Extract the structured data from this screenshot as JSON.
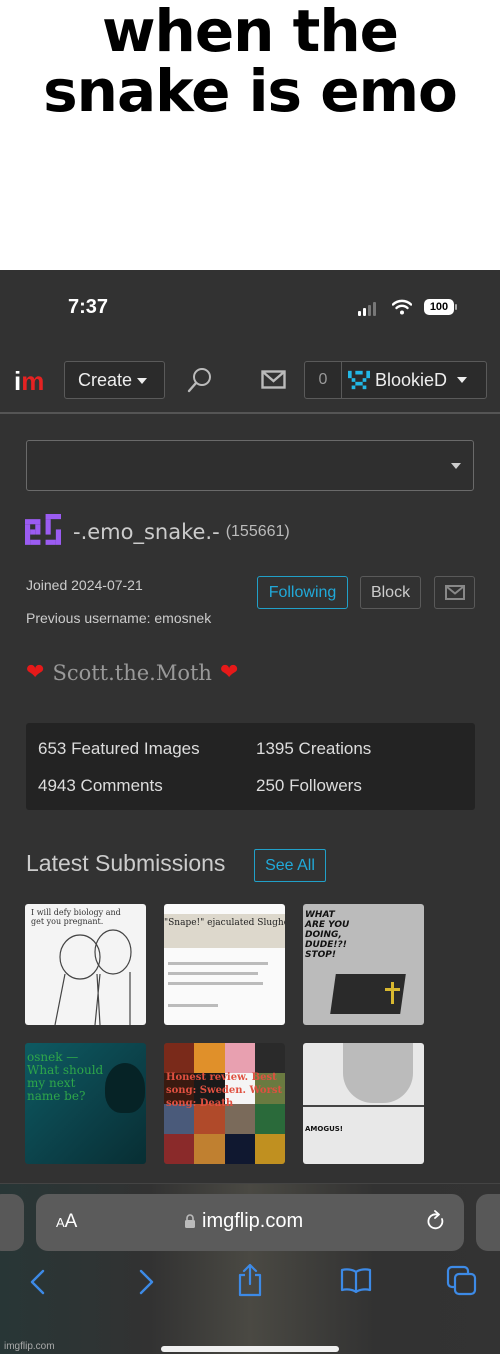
{
  "caption": {
    "line1": "when the",
    "line2": "snake is emo"
  },
  "status_bar": {
    "time": "7:37",
    "battery": "100"
  },
  "navbar": {
    "logo_i": "i",
    "logo_m": "m",
    "create_label": "Create",
    "notification_count": "0",
    "username": "BlookieD"
  },
  "profile": {
    "username": "-.emo_snake.-",
    "points": "(155661)",
    "joined": "Joined 2024-07-21",
    "previous_username": "Previous username: emosnek",
    "following_label": "Following",
    "block_label": "Block",
    "bio_heart": "❤",
    "bio_text": "Scott.the.Moth",
    "avatar_color": "#9b5cf2"
  },
  "stats": {
    "featured": "653 Featured Images",
    "creations": "1395 Creations",
    "comments": "4943 Comments",
    "followers": "250 Followers"
  },
  "latest": {
    "title": "Latest Submissions",
    "see_all": "See All",
    "thumbnails": [
      {
        "text": "I will defy biology and get you pregnant."
      },
      {
        "text": "\"Snape!\" ejaculated Slughorn"
      },
      {
        "text": "WHAT ARE YOU DOING, DUDE!?! STOP!"
      },
      {
        "text": "osnek — What should my next name be?"
      },
      {
        "text": "Honest review. Best song: Sweden. Worst song: Death"
      },
      {
        "text": "AMOGUS!"
      }
    ]
  },
  "browser": {
    "aa_small": "A",
    "aa_large": "A",
    "url": "imgflip.com"
  },
  "watermark": "imgflip.com",
  "colors": {
    "accent": "#21a9d9",
    "logo_red": "#e52222",
    "background": "#323232",
    "ios_blue": "#3d8ae6"
  }
}
